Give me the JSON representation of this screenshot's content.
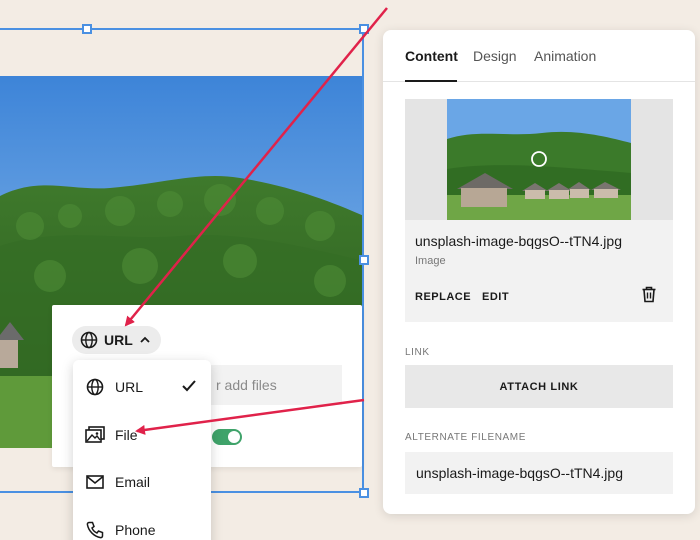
{
  "canvas": {
    "link_type_selected": "URL",
    "file_input_placeholder": "r add files",
    "toggle_state": "on"
  },
  "link_type_menu": {
    "items": [
      {
        "label": "URL",
        "icon": "globe-icon",
        "checked": true
      },
      {
        "label": "File",
        "icon": "image-file-icon",
        "checked": false
      },
      {
        "label": "Email",
        "icon": "envelope-icon",
        "checked": false
      },
      {
        "label": "Phone",
        "icon": "phone-icon",
        "checked": false
      }
    ]
  },
  "panel": {
    "tabs": [
      {
        "label": "Content",
        "active": true
      },
      {
        "label": "Design",
        "active": false
      },
      {
        "label": "Animation",
        "active": false
      }
    ],
    "media": {
      "file_name": "unsplash-image-bqgsO--tTN4.jpg",
      "file_type": "Image",
      "replace_label": "REPLACE",
      "edit_label": "EDIT"
    },
    "link_section": {
      "label": "LINK",
      "attach_label": "ATTACH LINK"
    },
    "alt_filename_section": {
      "label": "ALTERNATE FILENAME",
      "value": "unsplash-image-bqgsO--tTN4.jpg"
    }
  },
  "colors": {
    "background": "#f3ece4",
    "selection_blue": "#4a90e2",
    "annotation_arrow": "#e0224a",
    "toggle_green": "#3fa36a"
  }
}
